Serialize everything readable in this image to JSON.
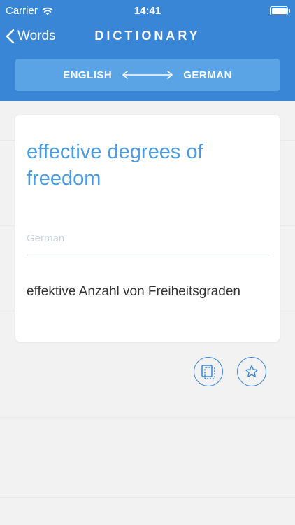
{
  "status": {
    "carrier": "Carrier",
    "time": "14:41"
  },
  "nav": {
    "back_label": "Words",
    "title": "DICTIONARY"
  },
  "language_bar": {
    "source": "ENGLISH",
    "target": "GERMAN"
  },
  "entry": {
    "term": "effective degrees of freedom",
    "target_language_label": "German",
    "translation": "effektive Anzahl von Freiheitsgraden"
  },
  "colors": {
    "accent": "#3a86d6",
    "term_text": "#4a9ae0",
    "language_bar": "#5aa4e6"
  },
  "icons": {
    "wifi": "wifi-icon",
    "battery": "battery-icon",
    "back": "chevron-left-icon",
    "swap": "double-arrow-icon",
    "copy": "copy-card-icon",
    "favorite": "star-icon"
  }
}
